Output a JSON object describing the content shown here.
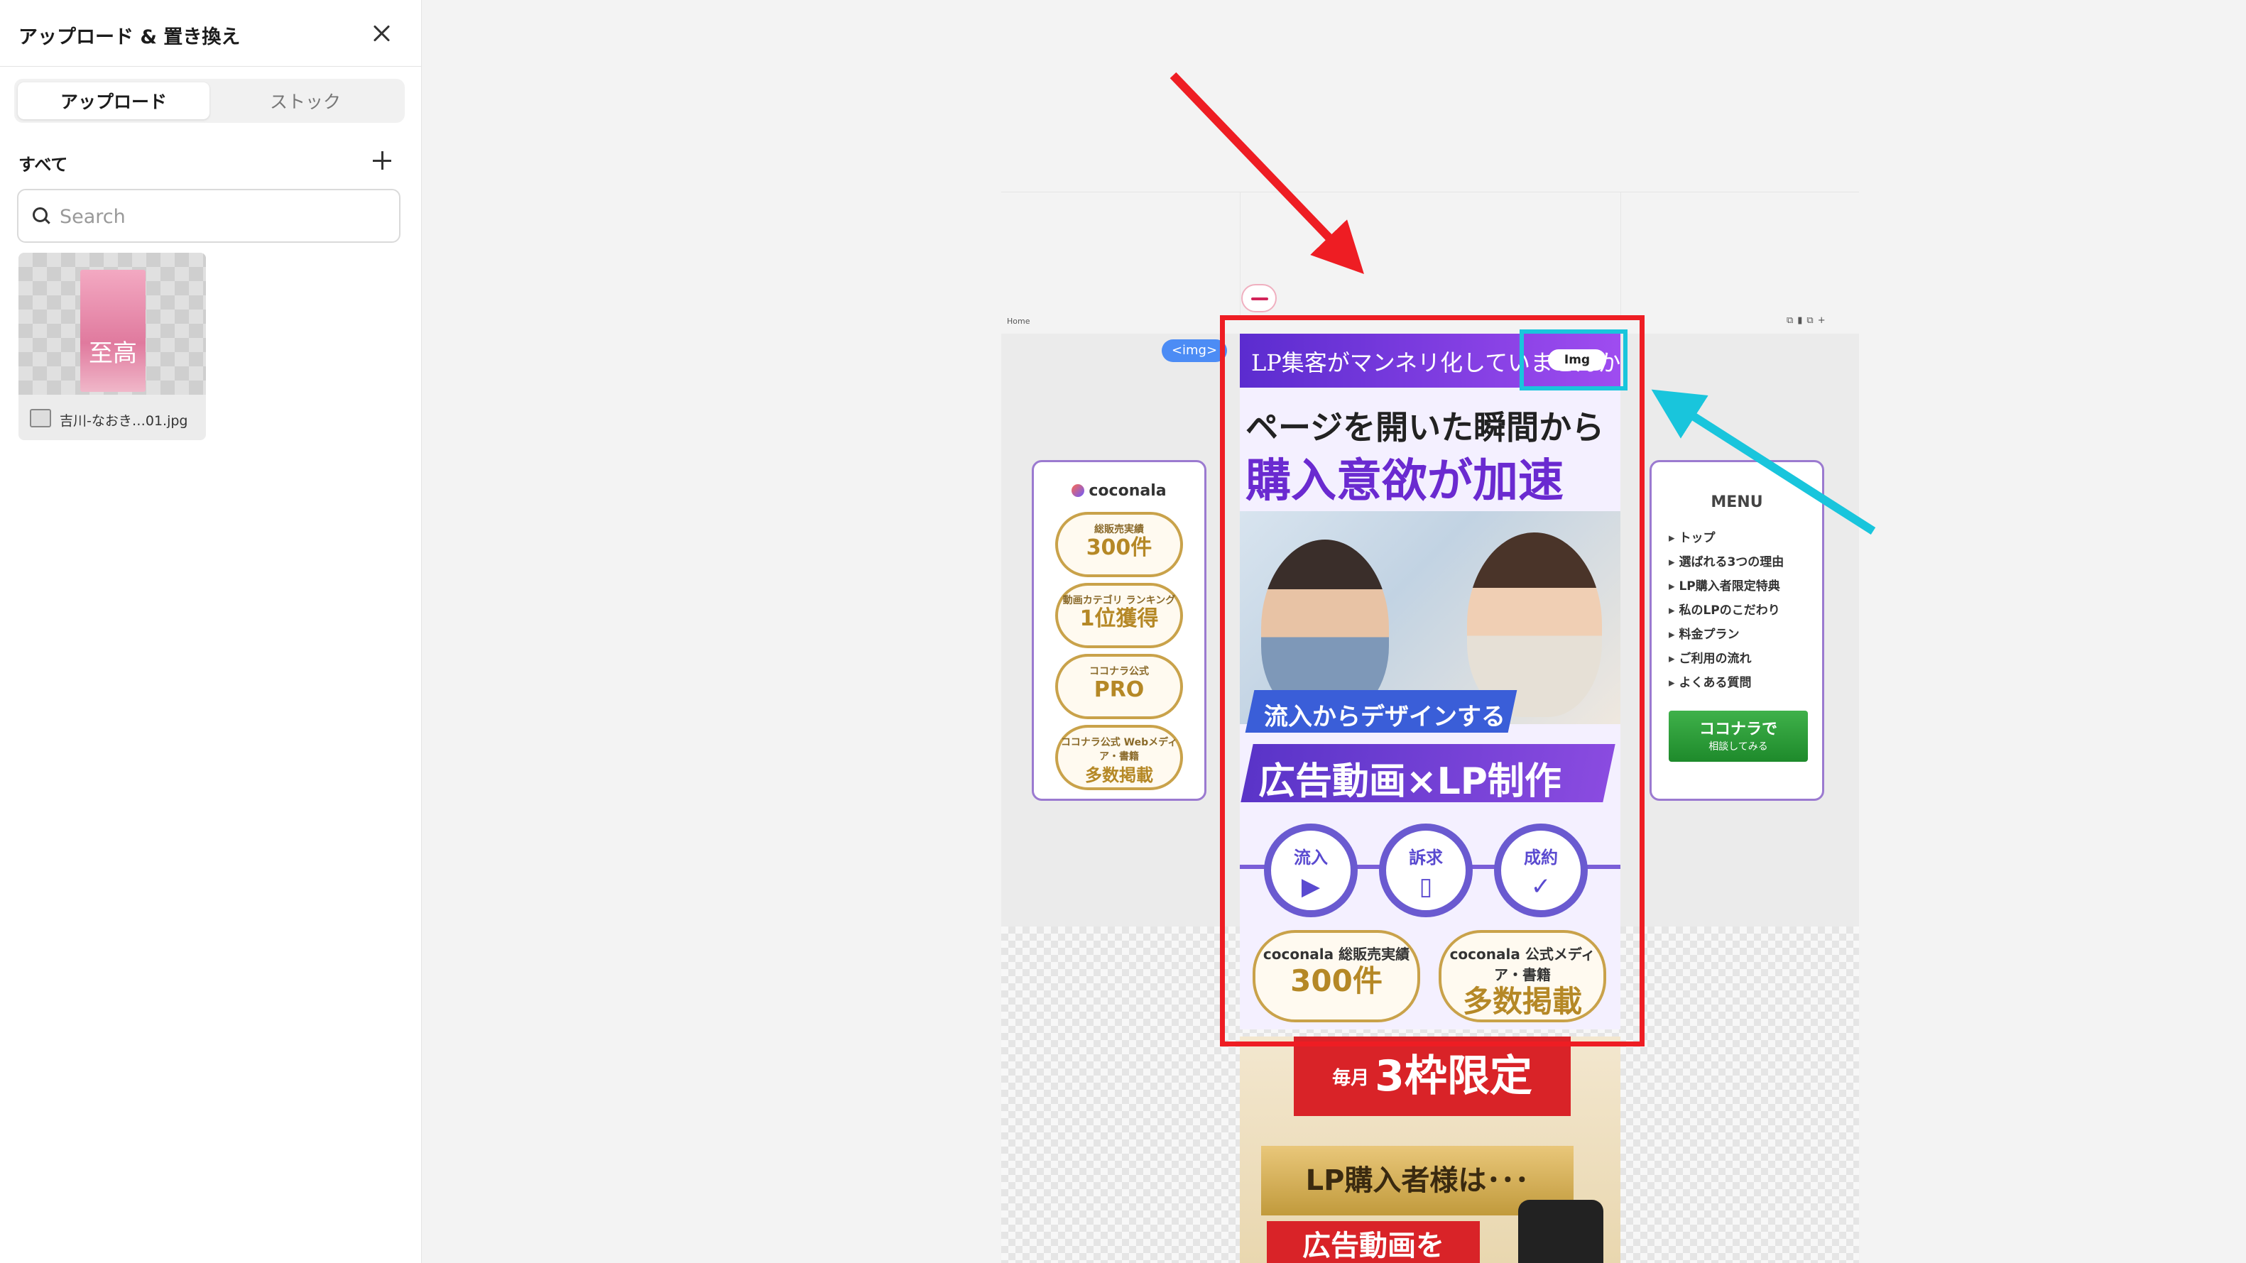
{
  "panel": {
    "title": "アップロード & 置き換え",
    "tabs": [
      {
        "label": "アップロード",
        "active": true
      },
      {
        "label": "ストック",
        "active": false
      }
    ],
    "section_label": "すべて",
    "search": {
      "placeholder": "Search",
      "value": ""
    },
    "assets": [
      {
        "name": "吉川-なおき…01.jpg",
        "thumb_text": "至高"
      }
    ]
  },
  "canvas": {
    "frame_label": "Home",
    "img_tag": "<img>",
    "selected_chip": "Img",
    "left_card": {
      "brand": "coconala",
      "awards": [
        {
          "small": "総販売実績",
          "big": "300件"
        },
        {
          "small": "動画カテゴリ ランキング",
          "big": "1位獲得"
        },
        {
          "small": "ココナラ公式",
          "big": "PRO"
        },
        {
          "small": "ココナラ公式 Webメディア・書籍",
          "big": "多数掲載"
        }
      ]
    },
    "right_card": {
      "menu_title": "MENU",
      "menu_items": [
        "トップ",
        "選ばれる3つの理由",
        "LP購入者限定特典",
        "私のLPのこだわり",
        "料金プラン",
        "ご利用の流れ",
        "よくある質問"
      ],
      "cta_main": "ココナラで",
      "cta_sub": "相談してみる"
    },
    "banner": {
      "top_text": "LP集客がマンネリ化していませんか",
      "headline1": "ページを開いた瞬間から",
      "headline2": "購入意欲が加速",
      "ribbon1": "流入からデザインする",
      "ribbon2": "広告動画×LP制作",
      "steps": [
        {
          "label": "流入",
          "glyph": "▶"
        },
        {
          "label": "訴求",
          "glyph": "▯"
        },
        {
          "label": "成約",
          "glyph": "✓"
        }
      ],
      "badges": [
        {
          "sub": "coconala 総販売実績",
          "main": "300件"
        },
        {
          "sub": "coconala 公式メディア・書籍",
          "main": "多数掲載"
        }
      ]
    },
    "limit": {
      "small": "毎月",
      "main": "3枠限定"
    },
    "gold_bar": "LP購入者様は･･･",
    "red_bar": "広告動画を"
  },
  "colors": {
    "selection_red": "#ee1d23",
    "selection_cyan": "#19c5dc",
    "accent_purple": "#6a2ad0"
  }
}
